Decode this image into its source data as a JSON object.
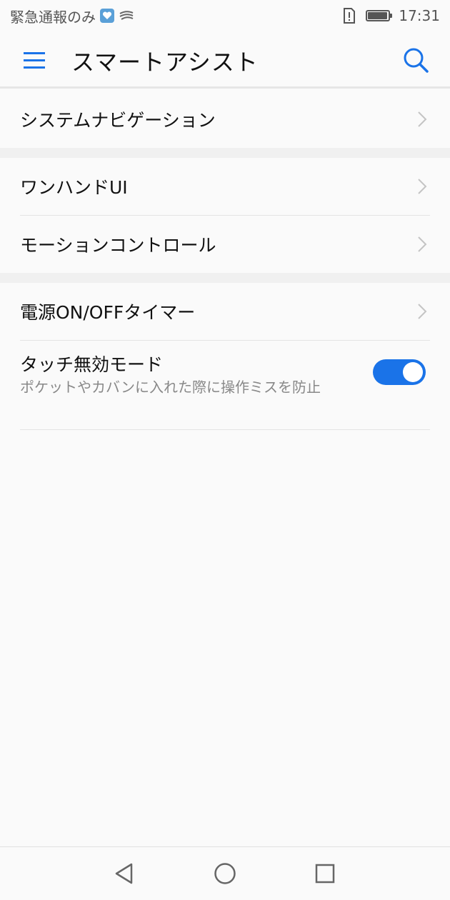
{
  "status_bar": {
    "carrier": "緊急通報のみ",
    "time": "17:31",
    "battery_level": 0.95,
    "icons": [
      "notification-heart-icon",
      "swiftkey-icon",
      "sim-alert-icon",
      "battery-icon"
    ]
  },
  "app_bar": {
    "title": "スマートアシスト",
    "icons": [
      "menu-icon",
      "search-icon"
    ],
    "accent_color": "#1a73e8"
  },
  "groups": [
    {
      "items": [
        {
          "label": "システムナビゲーション"
        }
      ]
    },
    {
      "items": [
        {
          "label": "ワンハンドUI"
        },
        {
          "label": "モーションコントロール"
        }
      ]
    },
    {
      "items": [
        {
          "label": "電源ON/OFFタイマー"
        },
        {
          "label": "タッチ無効モード",
          "description": "ポケットやカバンに入れた際に操作ミスを防止",
          "toggle_on": true
        }
      ]
    }
  ],
  "nav_bar": {
    "icons": [
      "back-icon",
      "home-icon",
      "recents-icon"
    ]
  }
}
